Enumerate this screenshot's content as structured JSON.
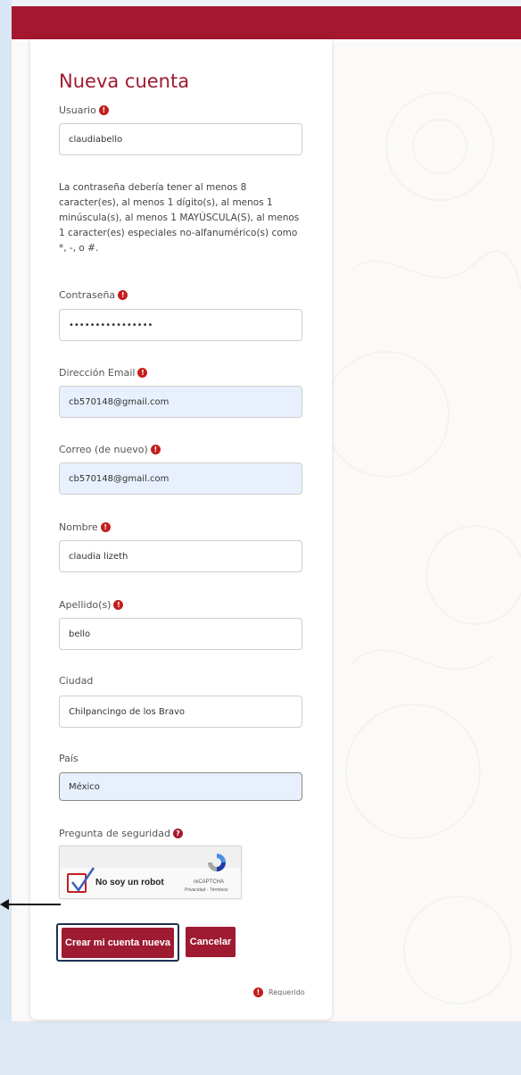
{
  "form": {
    "title": "Nueva cuenta",
    "username": {
      "label": "Usuario",
      "value": "claudiabello"
    },
    "password_note": "La contraseña debería tener al menos 8 caracter(es), al menos 1 dígito(s), al menos 1 minúscula(s), al menos 1 MAYÚSCULA(S), al menos 1 caracter(es) especiales no-alfanumérico(s) como *, -, o #.",
    "password": {
      "label": "Contraseña",
      "value": "••••••••••••••••"
    },
    "email": {
      "label": "Dirección Email",
      "value": "cb570148@gmail.com"
    },
    "email_confirm": {
      "label": "Correo (de nuevo)",
      "value": "cb570148@gmail.com"
    },
    "first_name": {
      "label": "Nombre",
      "value": "claudia lizeth"
    },
    "last_name": {
      "label": "Apellido(s)",
      "value": "bello"
    },
    "city": {
      "label": "Ciudad",
      "value": "Chilpancingo de los Bravo"
    },
    "country": {
      "label": "País",
      "value": "México"
    },
    "security": {
      "label": "Pregunta de seguridad"
    },
    "required_glyph": "!",
    "help_glyph": "?"
  },
  "recaptcha": {
    "label": "No soy un robot",
    "brand": "reCAPTCHA",
    "links": "Privacidad - Términos",
    "checked": true
  },
  "buttons": {
    "create": "Crear mi cuenta nueva",
    "cancel": "Cancelar"
  },
  "legend": {
    "required_label": "Requerido"
  },
  "colors": {
    "brand": "#9e1b32",
    "header": "#a4172f",
    "required": "#c41e1e",
    "autofill": "#e8f0fd",
    "highlight_border": "#1f3050"
  }
}
